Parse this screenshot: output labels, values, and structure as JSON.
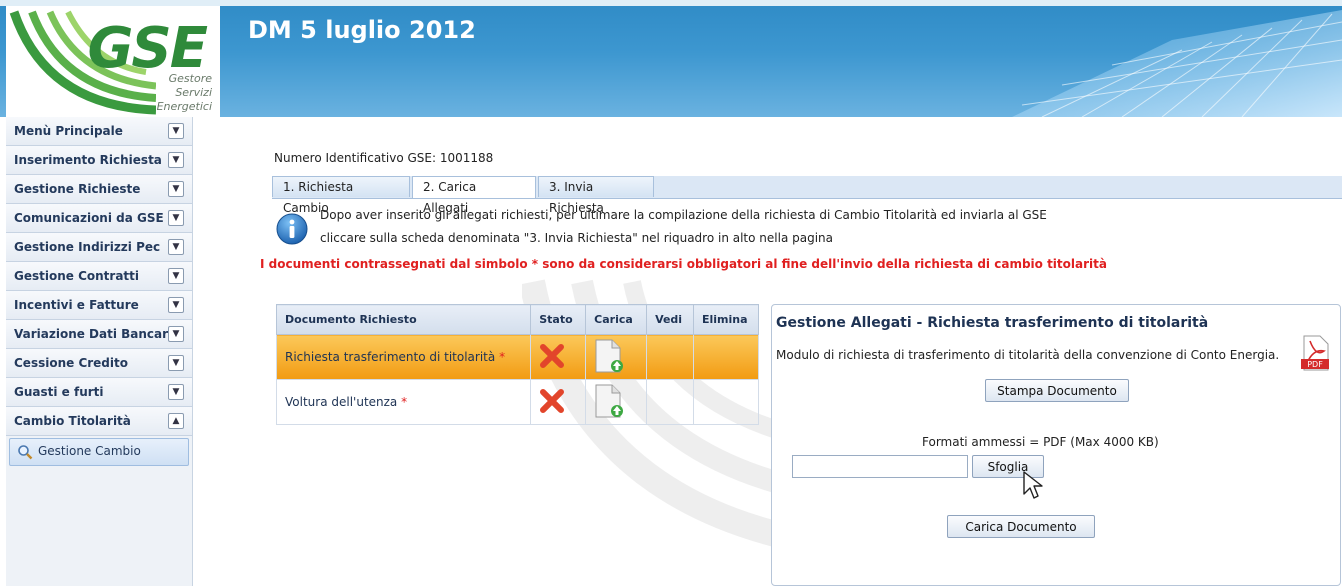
{
  "header": {
    "logo_text": "GSE",
    "logo_sub": [
      "Gestore",
      "Servizi",
      "Energetici"
    ],
    "title": "DM 5 luglio 2012"
  },
  "sidebar": {
    "items": [
      {
        "label": "Menù Principale",
        "expanded": false
      },
      {
        "label": "Inserimento Richiesta",
        "expanded": false
      },
      {
        "label": "Gestione Richieste",
        "expanded": false
      },
      {
        "label": "Comunicazioni da GSE",
        "expanded": false
      },
      {
        "label": "Gestione Indirizzi Pec",
        "expanded": false
      },
      {
        "label": "Gestione Contratti",
        "expanded": false
      },
      {
        "label": "Incentivi e Fatture",
        "expanded": false
      },
      {
        "label": "Variazione Dati Bancari",
        "expanded": false
      },
      {
        "label": "Cessione Credito",
        "expanded": false
      },
      {
        "label": "Guasti e furti",
        "expanded": false
      },
      {
        "label": "Cambio Titolarità",
        "expanded": true
      }
    ],
    "subitem": {
      "label": "Gestione Cambio"
    }
  },
  "main": {
    "id_label": "Numero Identificativo GSE: 1001188",
    "tabs": [
      {
        "label": "1. Richiesta Cambio",
        "active": false
      },
      {
        "label": "2. Carica Allegati",
        "active": true
      },
      {
        "label": "3. Invia Richiesta",
        "active": false
      }
    ],
    "info_line1": "Dopo aver inserito gli allegati richiesti, per ultimare la compilazione della richiesta di Cambio Titolarità ed inviarla al GSE",
    "info_line2": "cliccare sulla scheda denominata \"3. Invia Richiesta\" nel riquadro in alto nella pagina",
    "warning": "I documenti contrassegnati dal simbolo * sono da considerarsi obbligatori al fine dell'invio della richiesta di cambio titolarità",
    "table": {
      "columns": [
        "Documento Richiesto",
        "Stato",
        "Carica",
        "Vedi",
        "Elimina"
      ],
      "rows": [
        {
          "document": "Richiesta trasferimento di titolarità",
          "required": "*",
          "status": "missing",
          "selected": true
        },
        {
          "document": "Voltura dell'utenza",
          "required": "*",
          "status": "missing",
          "selected": false
        }
      ]
    },
    "panel": {
      "title": "Gestione Allegati - Richiesta trasferimento di titolarità",
      "description": "Modulo di richiesta di trasferimento di titolarità della convenzione di Conto Energia.",
      "pdf_label": "PDF",
      "print_button": "Stampa Documento",
      "formats": "Formati ammessi = PDF (Max 4000 KB)",
      "file_value": "",
      "browse_button": "Sfoglia",
      "upload_button": "Carica Documento"
    }
  },
  "colors": {
    "header_blue": "#3d97d0",
    "logo_green": "#2f8a3a",
    "selected_row": "#f29b12",
    "error_red": "#e02020",
    "menu_text": "#243a5c"
  }
}
